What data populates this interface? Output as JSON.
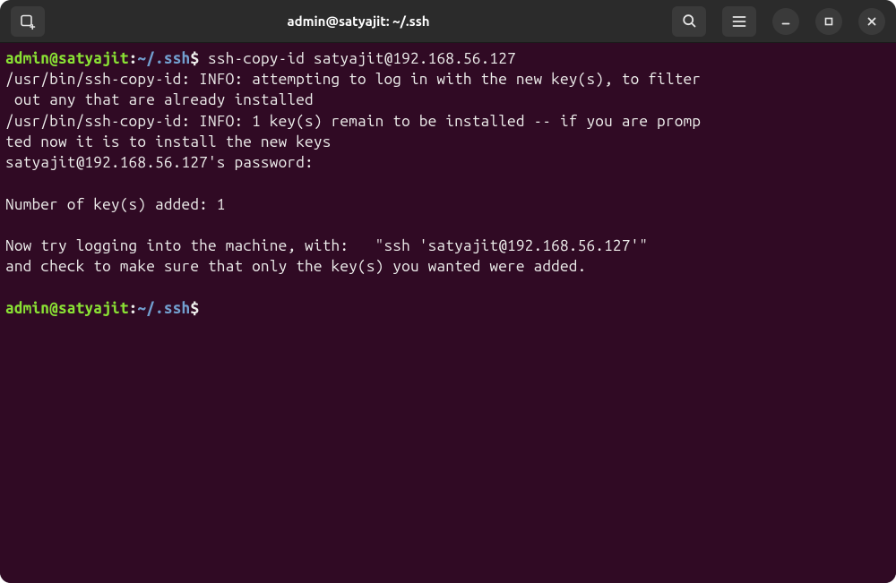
{
  "titlebar": {
    "title": "admin@satyajit: ~/.ssh"
  },
  "prompt": {
    "user_host": "admin@satyajit",
    "colon": ":",
    "path": "~/.ssh",
    "dollar": "$"
  },
  "line1": {
    "command": " ssh-copy-id satyajit@192.168.56.127"
  },
  "out1": "/usr/bin/ssh-copy-id: INFO: attempting to log in with the new key(s), to filter",
  "out2": " out any that are already installed",
  "out3": "/usr/bin/ssh-copy-id: INFO: 1 key(s) remain to be installed -- if you are promp",
  "out4": "ted now it is to install the new keys",
  "out5": "satyajit@192.168.56.127's password:",
  "blank": " ",
  "out6": "Number of key(s) added: 1",
  "out7": "Now try logging into the machine, with:   \"ssh 'satyajit@192.168.56.127'\"",
  "out8": "and check to make sure that only the key(s) you wanted were added."
}
